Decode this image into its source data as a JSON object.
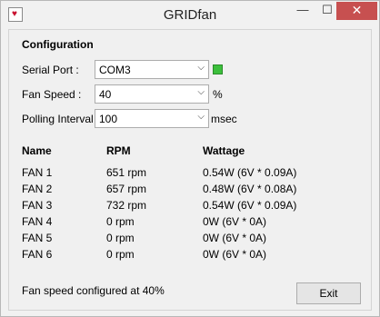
{
  "window": {
    "title": "GRIDfan",
    "min_glyph": "—",
    "max_glyph": "☐",
    "close_glyph": "✕"
  },
  "config": {
    "heading": "Configuration",
    "serial_port": {
      "label": "Serial Port :",
      "value": "COM3"
    },
    "fan_speed": {
      "label": "Fan Speed :",
      "value": "40",
      "unit": "%"
    },
    "polling": {
      "label": "Polling Interval :",
      "value": "100",
      "unit": "msec"
    },
    "connection_status_color": "#3cbf3c"
  },
  "table": {
    "headers": [
      "Name",
      "RPM",
      "Wattage"
    ],
    "rows": [
      [
        "FAN 1",
        "651 rpm",
        "0.54W (6V * 0.09A)"
      ],
      [
        "FAN 2",
        "657 rpm",
        "0.48W (6V * 0.08A)"
      ],
      [
        "FAN 3",
        "732 rpm",
        "0.54W (6V * 0.09A)"
      ],
      [
        "FAN 4",
        "0 rpm",
        "0W (6V * 0A)"
      ],
      [
        "FAN 5",
        "0 rpm",
        "0W (6V * 0A)"
      ],
      [
        "FAN 6",
        "0 rpm",
        "0W (6V * 0A)"
      ]
    ]
  },
  "footer": {
    "status": "Fan speed configured at 40%",
    "exit_label": "Exit"
  },
  "icons": {
    "app": "heart-icon",
    "dropdown": "chevron-down-icon"
  }
}
